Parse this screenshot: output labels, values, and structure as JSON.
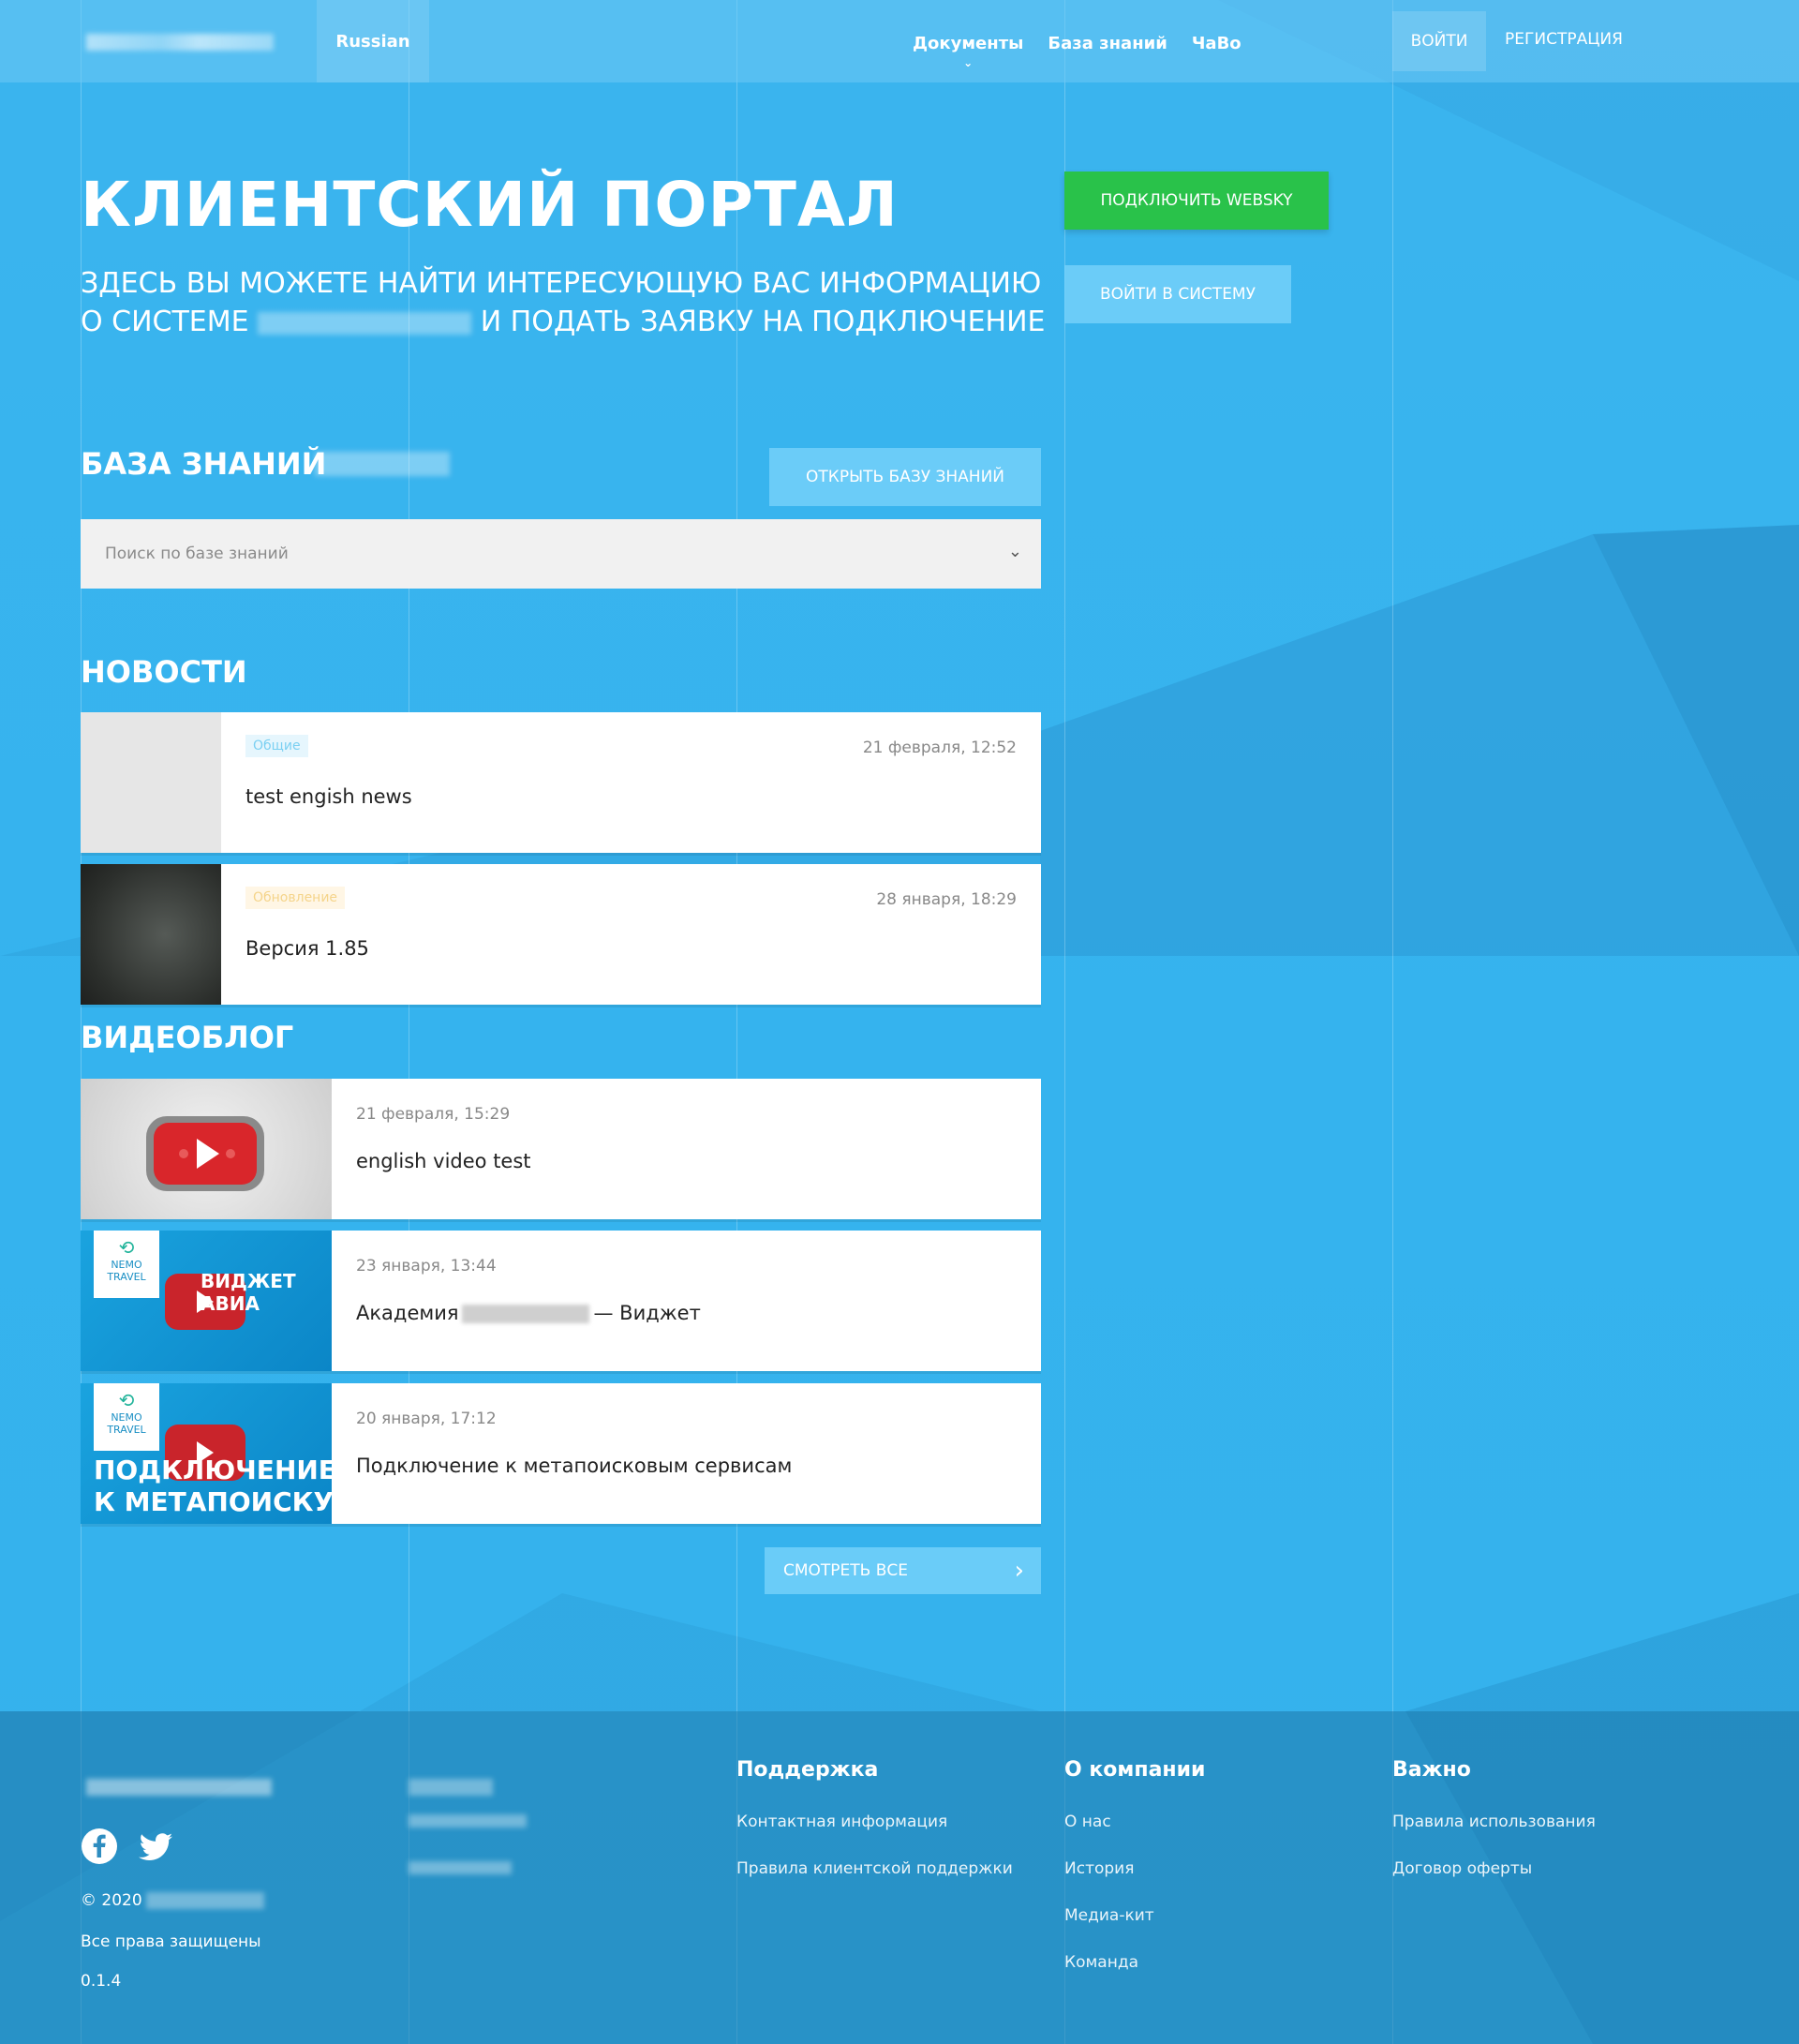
{
  "header": {
    "language": "Russian",
    "nav": [
      "Документы",
      "База знаний",
      "ЧаВо"
    ],
    "login": "ВОЙТИ",
    "register": "РЕГИСТРАЦИЯ"
  },
  "hero": {
    "title": "КЛИЕНТСКИЙ ПОРТАЛ",
    "subtitle_part1": "ЗДЕСЬ ВЫ МОЖЕТЕ НАЙТИ ИНТЕРЕСУЮЩУЮ ВАС ИНФОРМАЦИЮ О СИСТЕМЕ",
    "subtitle_part2": "И ПОДАТЬ ЗАЯВКУ НА ПОДКЛЮЧЕНИЕ",
    "connect_btn": "ПОДКЛЮЧИТЬ WEBSKY",
    "enter_btn": "ВОЙТИ В СИСТЕМУ"
  },
  "knowledge_base": {
    "title": "БАЗА ЗНАНИЙ",
    "open_btn": "ОТКРЫТЬ БАЗУ ЗНАНИЙ",
    "search_placeholder": "Поиск по базе знаний"
  },
  "news": {
    "title": "НОВОСТИ",
    "items": [
      {
        "badge": "Общие",
        "date": "21 февраля, 12:52",
        "title": "test engish news"
      },
      {
        "badge": "Обновление",
        "date": "28 января, 18:29",
        "title": "Версия 1.85"
      }
    ]
  },
  "videoblog": {
    "title": "ВИДЕОБЛОГ",
    "items": [
      {
        "date": "21 февраля, 15:29",
        "title": "english video test"
      },
      {
        "date": "23 января, 13:44",
        "title_pre": "Академия",
        "title_post": "— Виджет",
        "thumb_text": [
          "ВИДЖЕТ",
          "АВИА"
        ],
        "thumb_logo": [
          "NEMO",
          "TRAVEL"
        ]
      },
      {
        "date": "20 января, 17:12",
        "title": "Подключение к метапоисковым сервисам",
        "thumb_text": [
          "ПОДКЛЮЧЕНИЕ",
          "К МЕТАПОИСКУ"
        ],
        "thumb_logo": [
          "NEMO",
          "TRAVEL"
        ]
      }
    ],
    "see_all": "СМОТРЕТЬ ВСЕ"
  },
  "footer": {
    "support": {
      "title": "Поддержка",
      "links": [
        "Контактная информация",
        "Правила клиентской поддержки"
      ]
    },
    "company": {
      "title": "О компании",
      "links": [
        "О нас",
        "История",
        "Медиа-кит",
        "Команда"
      ]
    },
    "important": {
      "title": "Важно",
      "links": [
        "Правила использования",
        "Договор оферты"
      ]
    },
    "copyright": "© 2020",
    "rights": "Все права защищены",
    "version": "0.1.4"
  },
  "colors": {
    "background": "#35b3ee",
    "accent_green": "#29c24a",
    "badge_general": "#7bd0f2",
    "badge_update": "#f5d48a"
  },
  "icons": [
    "chevron-down-icon",
    "facebook-icon",
    "twitter-icon",
    "youtube-play-icon",
    "chevron-right-icon"
  ]
}
